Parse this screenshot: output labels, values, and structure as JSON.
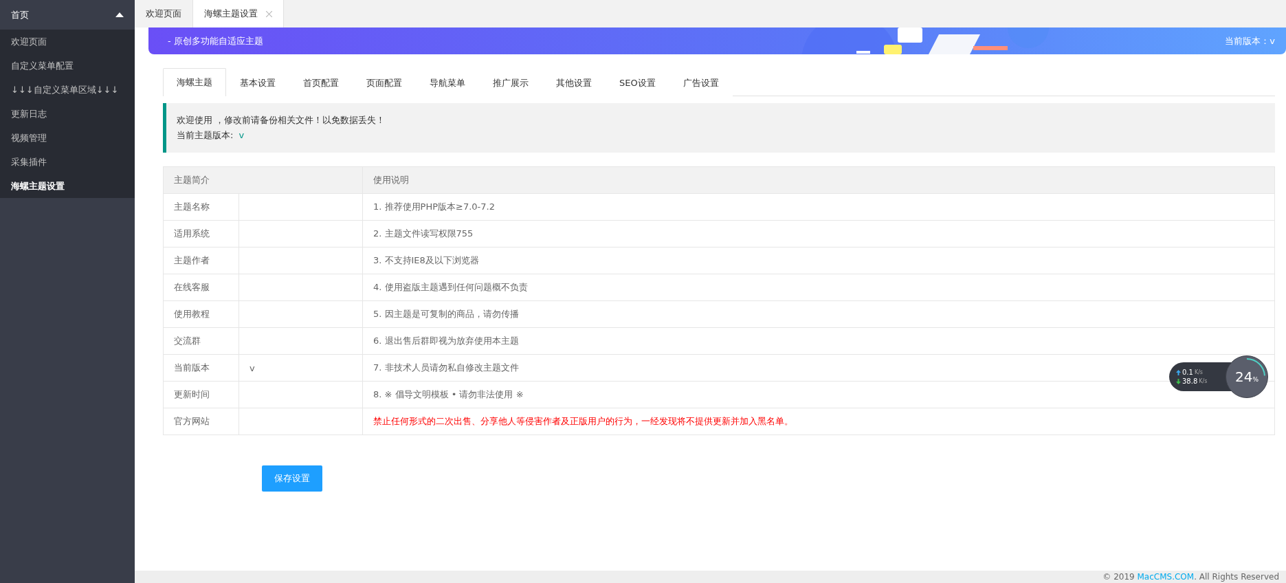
{
  "sidebar": {
    "header": {
      "label": "首页",
      "expanded": true
    },
    "items": [
      {
        "label": "欢迎页面",
        "selected": false
      },
      {
        "label": "自定义菜单配置",
        "selected": false
      },
      {
        "label": "↓↓↓自定义菜单区域↓↓↓",
        "selected": false
      },
      {
        "label": "更新日志",
        "selected": false
      },
      {
        "label": "视频管理",
        "selected": false
      },
      {
        "label": "采集插件",
        "selected": false
      },
      {
        "label": "海螺主题设置",
        "selected": true
      }
    ]
  },
  "page_tabs": [
    {
      "label": "欢迎页面",
      "selected": false,
      "closable": false
    },
    {
      "label": "海螺主题设置",
      "selected": true,
      "closable": true
    }
  ],
  "banner": {
    "subtitle": "- 原创多功能自适应主题",
    "version": "当前版本：v"
  },
  "settings_tabs": [
    {
      "label": "海螺主题",
      "selected": true
    },
    {
      "label": "基本设置",
      "selected": false
    },
    {
      "label": "首页配置",
      "selected": false
    },
    {
      "label": "页面配置",
      "selected": false
    },
    {
      "label": "导航菜单",
      "selected": false
    },
    {
      "label": "推广展示",
      "selected": false
    },
    {
      "label": "其他设置",
      "selected": false
    },
    {
      "label": "SEO设置",
      "selected": false
    },
    {
      "label": "广告设置",
      "selected": false
    }
  ],
  "notice": {
    "line_1": "欢迎使用 ，修改前请备份相关文件！以免数据丢失！",
    "line_2_label": "当前主题版本:",
    "line_2_value": "v"
  },
  "table": {
    "columns": [
      "主题简介",
      "使用说明"
    ],
    "rows": [
      {
        "label": "主题名称",
        "value": "",
        "note": "1. 推荐使用PHP版本≥7.0-7.2",
        "warning": false
      },
      {
        "label": "适用系统",
        "value": "",
        "note": "2. 主题文件读写权限755",
        "warning": false
      },
      {
        "label": "主题作者",
        "value": "",
        "note": "3. 不支持IE8及以下浏览器",
        "warning": false
      },
      {
        "label": "在线客服",
        "value": "",
        "note": "4. 使用盗版主题遇到任何问题概不负责",
        "warning": false
      },
      {
        "label": "使用教程",
        "value": "",
        "note": "5. 因主题是可复制的商品，请勿传播",
        "warning": false
      },
      {
        "label": "交流群",
        "value": "",
        "note": "6. 退出售后群即视为放弃使用本主题",
        "warning": false
      },
      {
        "label": "当前版本",
        "value": "v",
        "note": "7. 非技术人员请勿私自修改主题文件",
        "warning": false
      },
      {
        "label": "更新时间",
        "value": "",
        "note": "8. ※ 倡导文明模板 • 请勿非法使用 ※",
        "warning": false
      },
      {
        "label": "官方网站",
        "value": "",
        "note": "禁止任何形式的二次出售、分享他人等侵害作者及正版用户的行为，一经发现将不提供更新并加入黑名单。",
        "warning": true
      }
    ]
  },
  "save_button": "保存设置",
  "footer": {
    "prefix": "© 2019",
    "link": "MacCMS.COM",
    "suffix": ". All Rights Reserved"
  },
  "net_widget": {
    "upload": "0.1",
    "upload_unit": "K/s",
    "download": "38.8",
    "download_unit": "K/s",
    "percent": "24",
    "percent_unit": "%"
  }
}
